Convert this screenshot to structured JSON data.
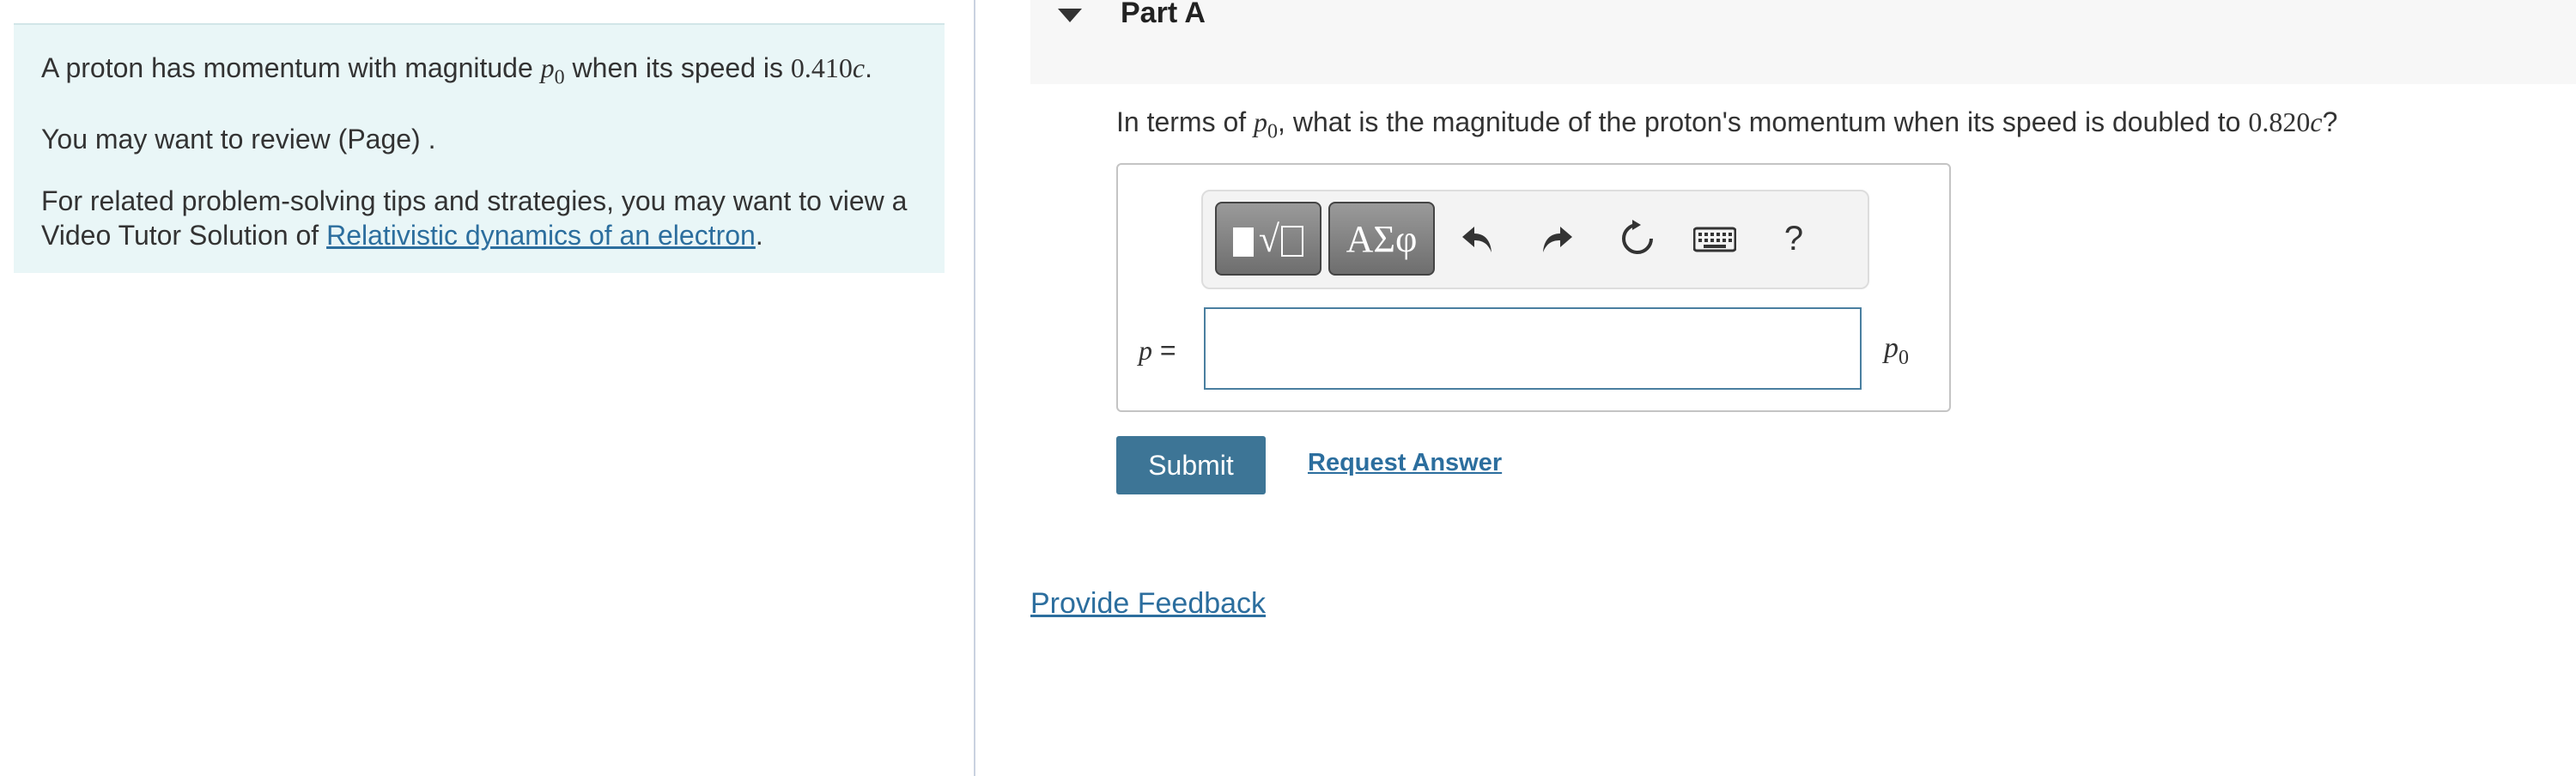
{
  "problem": {
    "intro_prefix": "A proton has momentum with magnitude ",
    "p0_symbol": "p",
    "p0_sub": "0",
    "intro_mid": " when its speed is ",
    "speed_value": "0.410",
    "c_symbol": "c",
    "intro_suffix": ".",
    "review_text": "You may want to review (Page) .",
    "tips_prefix": "For related problem-solving tips and strategies, you may want to view a Video Tutor Solution of ",
    "tips_link": "Relativistic dynamics of an electron",
    "tips_suffix": "."
  },
  "part": {
    "title": "Part A",
    "question_prefix": "In terms of ",
    "question_mid": ", what is the magnitude of the proton's momentum when its speed is doubled to ",
    "question_speed": "0.820",
    "question_suffix": "?"
  },
  "toolbar": {
    "templates_root": "√",
    "symbols_label": "ΑΣφ",
    "undo_icon": "undo-icon",
    "redo_icon": "redo-icon",
    "reset_icon": "reset-icon",
    "keyboard_icon": "keyboard-icon",
    "help_label": "?"
  },
  "answer": {
    "variable": "p",
    "equals": " =",
    "value": "",
    "unit_symbol": "p",
    "unit_sub": "0"
  },
  "actions": {
    "submit_label": "Submit",
    "request_answer_label": "Request Answer",
    "feedback_label": "Provide Feedback"
  },
  "colors": {
    "left_panel_bg": "#e9f6f7",
    "link": "#2c6e9e",
    "submit_bg": "#3d7596",
    "input_border": "#4a7fa0"
  }
}
